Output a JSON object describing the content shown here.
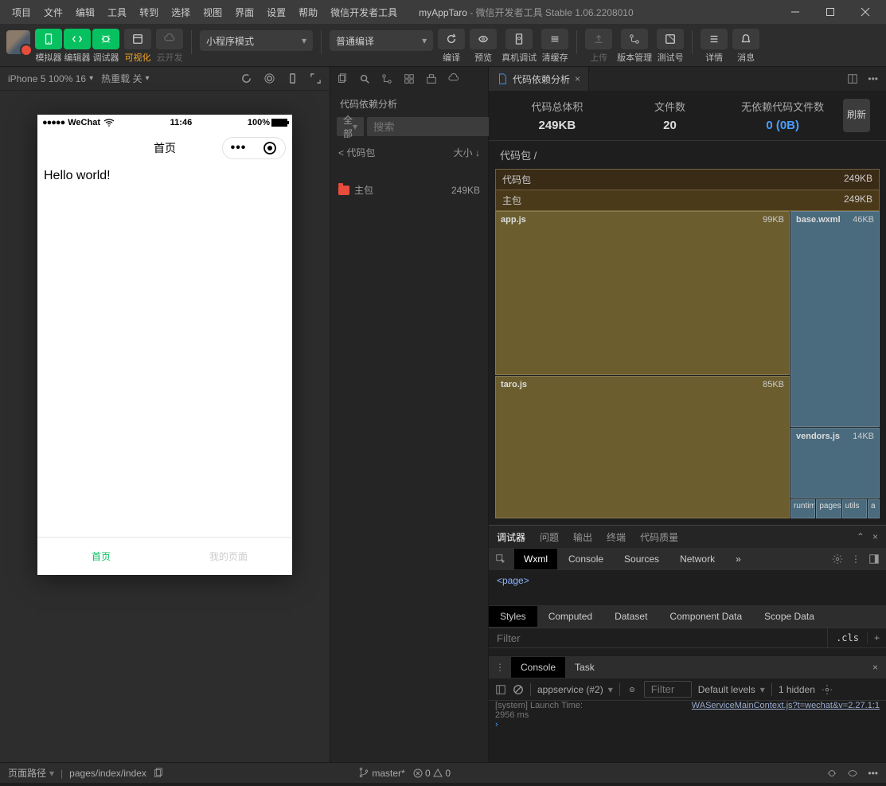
{
  "menubar": [
    "项目",
    "文件",
    "编辑",
    "工具",
    "转到",
    "选择",
    "视图",
    "界面",
    "设置",
    "帮助",
    "微信开发者工具"
  ],
  "title": {
    "app": "myAppTaro",
    "suffix": " - 微信开发者工具 Stable 1.06.2208010"
  },
  "toolbar": {
    "labels": {
      "sim": "模拟器",
      "editor": "编辑器",
      "debugger": "调试器",
      "visual": "可视化",
      "cloud": "云开发"
    },
    "mode": "小程序模式",
    "compile": "普通编译",
    "actions": {
      "compile_btn": "编译",
      "preview": "预览",
      "realdebug": "真机调试",
      "clearcache": "清缓存",
      "upload": "上传",
      "version": "版本管理",
      "testnum": "测试号",
      "detail": "详情",
      "message": "消息"
    }
  },
  "sim": {
    "device": "iPhone 5 100% 16",
    "hotreload": "热重载 关",
    "status": {
      "carrier": "WeChat",
      "time": "11:46",
      "battery": "100%"
    },
    "nav_title": "首页",
    "content": "Hello world!",
    "tabs": {
      "home": "首页",
      "mine": "我的页面"
    }
  },
  "tree": {
    "title": "代码依赖分析",
    "filter_all": "全部",
    "search_placeholder": "搜索",
    "col1": "< 代码包",
    "col2": "大小 ↓",
    "items": [
      {
        "name": "主包",
        "size": "249KB"
      }
    ]
  },
  "analysis": {
    "tab_title": "代码依赖分析",
    "stats": {
      "totalsize_lbl": "代码总体积",
      "totalsize_val": "249KB",
      "files_lbl": "文件数",
      "files_val": "20",
      "nodep_lbl": "无依赖代码文件数",
      "nodep_val": "0 (0B)"
    },
    "refresh": "刷新",
    "breadcrumb": "代码包 /",
    "tm": {
      "root": {
        "name": "代码包",
        "size": "249KB"
      },
      "main": {
        "name": "主包",
        "size": "249KB"
      },
      "files": {
        "app": {
          "name": "app.js",
          "size": "99KB"
        },
        "taro": {
          "name": "taro.js",
          "size": "85KB"
        },
        "base": {
          "name": "base.wxml",
          "size": "46KB"
        },
        "vendors": {
          "name": "vendors.js",
          "size": "14KB"
        },
        "small": [
          "runtim",
          "pages",
          "utils",
          "a"
        ]
      }
    }
  },
  "devtools": {
    "toptabs": {
      "debugger": "调试器",
      "issues": "问题",
      "output": "输出",
      "terminal": "终端",
      "quality": "代码质量"
    },
    "tabs": [
      "Wxml",
      "Console",
      "Sources",
      "Network"
    ],
    "elements": "<page>",
    "styles_tabs": [
      "Styles",
      "Computed",
      "Dataset",
      "Component Data",
      "Scope Data"
    ],
    "filter_placeholder": "Filter",
    "cls": ".cls",
    "console_tabs": {
      "console": "Console",
      "task": "Task"
    },
    "console": {
      "context": "appservice (#2)",
      "filter": "Filter",
      "levels": "Default levels",
      "hidden": "1 hidden",
      "line1a": "[system] Launch Time: ",
      "line1b": "2956 ms",
      "link": "WAServiceMainContext.js?t=wechat&v=2.27.1:1"
    }
  },
  "statusbar": {
    "pathlabel": "页面路径",
    "path": "pages/index/index",
    "branch": "master*",
    "warnings": "0",
    "errors": "0"
  }
}
